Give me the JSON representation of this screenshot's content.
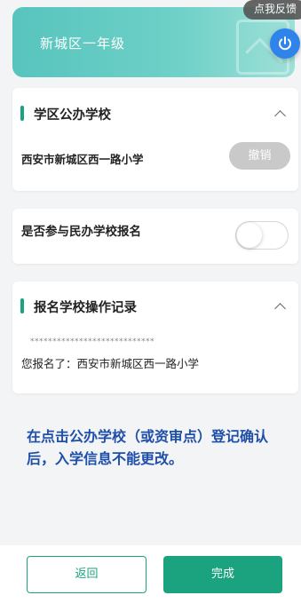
{
  "banner": {
    "title": "新城区一年级"
  },
  "overlay": {
    "feedback_label": "点我反馈"
  },
  "public_school": {
    "title": "学区公办学校",
    "school_name": "西安市新城区西一路小学",
    "cancel_label": "撤销"
  },
  "private_school": {
    "question": "是否参与民办学校报名",
    "toggle_on": false
  },
  "records": {
    "title": "报名学校操作记录",
    "masked_text": "****************************",
    "entry_text": "您报名了：西安市新城区西一路小学"
  },
  "notice": "在点击公办学校（或资审点）登记确认后，入学信息不能更改。",
  "footer": {
    "back_label": "返回",
    "done_label": "完成"
  },
  "colors": {
    "accent": "#1aa37e",
    "notice": "#1f4fa8",
    "banner": "#57c4bd",
    "power_button": "#2f84ec"
  }
}
